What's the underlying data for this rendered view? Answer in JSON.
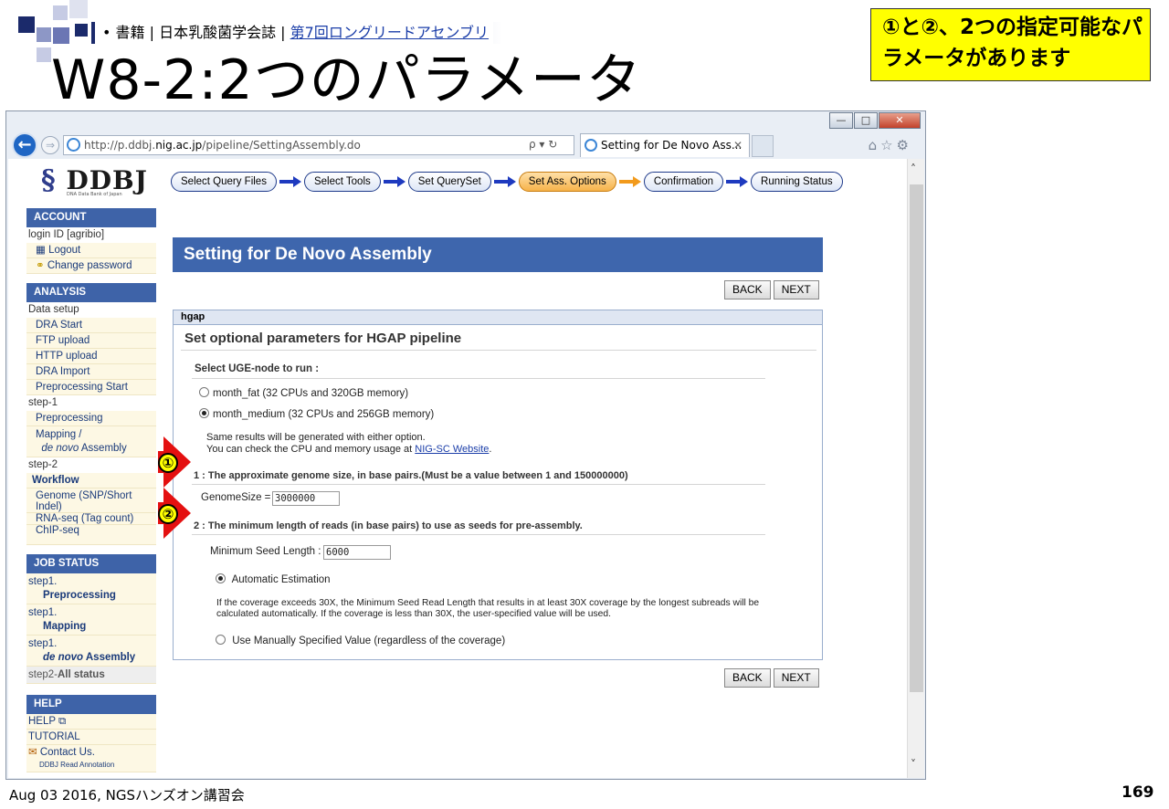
{
  "slide": {
    "header_prefix": "• 書籍 | 日本乳酸菌学会誌 | ",
    "header_link": "第7回ロングリードアセンブリ",
    "title": "W8-2:2つのパラメータ",
    "callout": "①と②、2つの指定可能なパラメータがあります",
    "footer_left": "Aug 03 2016, NGSハンズオン講習会",
    "page_number": "169",
    "markers": [
      "①",
      "②"
    ]
  },
  "browser": {
    "url_prefix": "http://p.ddbj.",
    "url_domain": "nig.ac.jp",
    "url_path": "/pipeline/SettingAssembly.do",
    "tab_title": "Setting for De Novo Ass...",
    "addr_tools": "ρ ▾ ↻",
    "nav_icons": "⌂☆⚙"
  },
  "logo": {
    "text": "DDBJ",
    "sub": "DNA Data Bank of Japan"
  },
  "steps": [
    "Select Query Files",
    "Select Tools",
    "Set QuerySet",
    "Set Ass. Options",
    "Confirmation",
    "Running Status"
  ],
  "sidebar": {
    "account_header": "ACCOUNT",
    "login_id": "login ID [agribio]",
    "logout": "Logout",
    "change_password": "Change password",
    "analysis_header": "ANALYSIS",
    "data_setup": "Data setup",
    "dra_start": "DRA Start",
    "ftp_upload": "FTP upload",
    "http_upload": "HTTP upload",
    "dra_import": "DRA Import",
    "preprocessing_start": "Preprocessing Start",
    "step1": "step-1",
    "preprocessing": "Preprocessing",
    "mapping_1": "Mapping /",
    "mapping_2_i": "de novo",
    "mapping_2": " Assembly",
    "step2": "step-2",
    "workflow": "Workflow",
    "genome": "Genome (SNP/Short Indel)",
    "rnaseq": "RNA-seq (Tag count)",
    "chipseq": "ChIP-seq",
    "job_header": "JOB STATUS",
    "js1": "step1.",
    "js1b": "Preprocessing",
    "js2": "step1.",
    "js2b": "Mapping",
    "js3": "step1.",
    "js3b_i": "de novo",
    "js3b": " Assembly",
    "js4": "step2-",
    "js4b": "All status",
    "help_header": "HELP",
    "help": "HELP ⧉",
    "tutorial": "TUTORIAL",
    "contact": "Contact Us.",
    "contact_sub": "DDBJ Read Annotation"
  },
  "main": {
    "banner": "Setting for De Novo Assembly",
    "back": "BACK",
    "next": "NEXT",
    "panel_header": "hgap",
    "panel_title": "Set optional parameters for HGAP pipeline",
    "uge_label": "Select UGE-node to run :",
    "opt_fat": "month_fat (32 CPUs and 320GB memory)",
    "opt_medium": "month_medium (32 CPUs and 256GB memory)",
    "note1": "Same results will be generated with either option.",
    "note2": "You can check the CPU and memory usage at ",
    "note_link": "NIG-SC Website",
    "note_end": ".",
    "p1_label": "1 : The approximate genome size, in base pairs.(Must be a value between 1 and 150000000)",
    "genome_size_label": "GenomeSize =",
    "genome_size_value": "3000000",
    "p2_label": "2 : The minimum length of reads (in base pairs) to use as seeds for pre-assembly.",
    "seed_label": "Minimum Seed Length :",
    "seed_value": "6000",
    "auto_est": "Automatic Estimation",
    "auto_desc1": "If the coverage exceeds 30X, the Minimum Seed Read Length that results in at least 30X coverage by the longest subreads will be",
    "auto_desc2": "calculated automatically. If the coverage is less than 30X, the user-specified value will be used.",
    "manual": "Use Manually Specified Value (regardless of the coverage)"
  }
}
